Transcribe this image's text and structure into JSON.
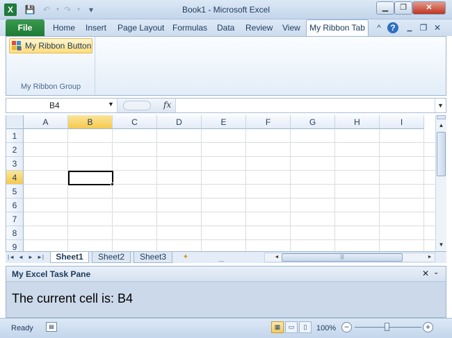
{
  "window": {
    "title": "Book1  -  Microsoft Excel",
    "logo_letter": "X"
  },
  "quick_access": {
    "save": "💾",
    "undo": "↶",
    "redo": "↷",
    "customize": "▾"
  },
  "window_controls": {
    "minimize": "▁",
    "restore": "❐",
    "close": "✕"
  },
  "ribbon": {
    "file_tab": "File",
    "tabs": [
      "Home",
      "Insert",
      "Page Layout",
      "Formulas",
      "Data",
      "Review",
      "View"
    ],
    "active_tab": "My Ribbon Tab",
    "controls": {
      "collapse": "^",
      "help": "?",
      "minimize": "▁",
      "restore": "❐",
      "close": "✕"
    },
    "group": {
      "button_label": "My Ribbon Button",
      "label": "My Ribbon Group"
    }
  },
  "formula_bar": {
    "name_box": "B4",
    "fx": "fx",
    "formula": ""
  },
  "grid": {
    "columns": [
      "A",
      "B",
      "C",
      "D",
      "E",
      "F",
      "G",
      "H",
      "I"
    ],
    "rows": [
      "1",
      "2",
      "3",
      "4",
      "5",
      "6",
      "7",
      "8",
      "9"
    ],
    "active_column": "B",
    "active_row": "4"
  },
  "sheet_tabs": {
    "nav": [
      "|◄",
      "◄",
      "►",
      "►|"
    ],
    "sheets": [
      "Sheet1",
      "Sheet2",
      "Sheet3"
    ],
    "active": "Sheet1",
    "split_handle": "....."
  },
  "task_pane": {
    "title": "My Excel Task Pane",
    "close": "✕",
    "menu": "⌄",
    "message": "The current cell is: B4"
  },
  "status_bar": {
    "ready": "Ready",
    "zoom": "100%",
    "zoom_out": "−",
    "zoom_in": "+"
  },
  "colors": {
    "accent_active_header": "#f5c94c",
    "file_tab": "#1d7a34",
    "task_pane_bg": "#cbd9ea"
  }
}
